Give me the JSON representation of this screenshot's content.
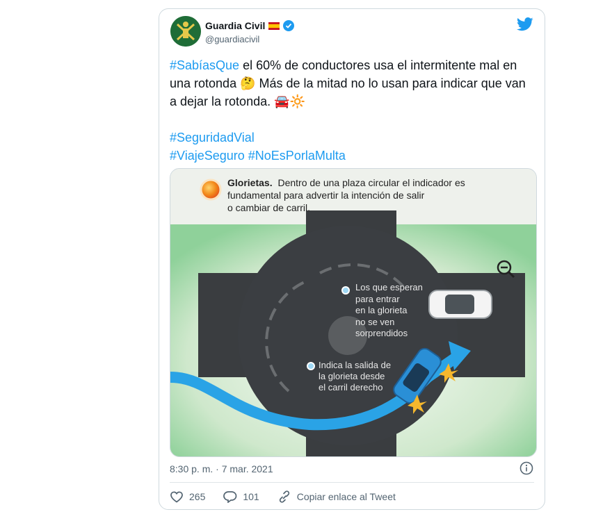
{
  "tweet": {
    "display_name": "Guardia Civil",
    "handle": "@guardiacivil",
    "flag": "🇪🇸",
    "hashtag1": "#SabíasQue",
    "line1_rest": " el 60% de conductores usa el intermitente mal en una rotonda ",
    "emoji_thinking": "🤔",
    "line2": " Más de la mitad no lo usan para indicar que van a dejar la rotonda. ",
    "emoji_car": "🚘",
    "emoji_sun": "🔆",
    "hashtag2": "#SeguridadVial",
    "hashtag3": "#ViajeSeguro",
    "hashtag4": "#NoEsPorlaMulta",
    "timestamp": "8:30 p. m. · 7 mar. 2021",
    "likes": "265",
    "replies": "101",
    "copy_link_label": "Copiar enlace al Tweet"
  },
  "infographic": {
    "title": "Glorietas.",
    "description_line1": "Dentro de una plaza circular el indicador es",
    "description_line2": "fundamental para advertir la intención de salir",
    "description_line3": "o cambiar de carril.",
    "label1_lines": [
      "Los que esperan",
      "para entrar",
      "en la glorieta",
      "no se ven",
      "sorprendidos"
    ],
    "label2_lines": [
      "Indica la salida de",
      "la glorieta desde",
      "el carril derecho"
    ]
  },
  "colors": {
    "link": "#1d9bf0",
    "secondary_text": "#536471",
    "verified": "#1d9bf0",
    "road": "#2f3336",
    "arrow": "#2aa3e6"
  },
  "icons": [
    "twitter-bird-icon",
    "verified-badge-icon",
    "info-icon",
    "heart-icon",
    "reply-icon",
    "link-icon",
    "zoom-out-icon"
  ]
}
